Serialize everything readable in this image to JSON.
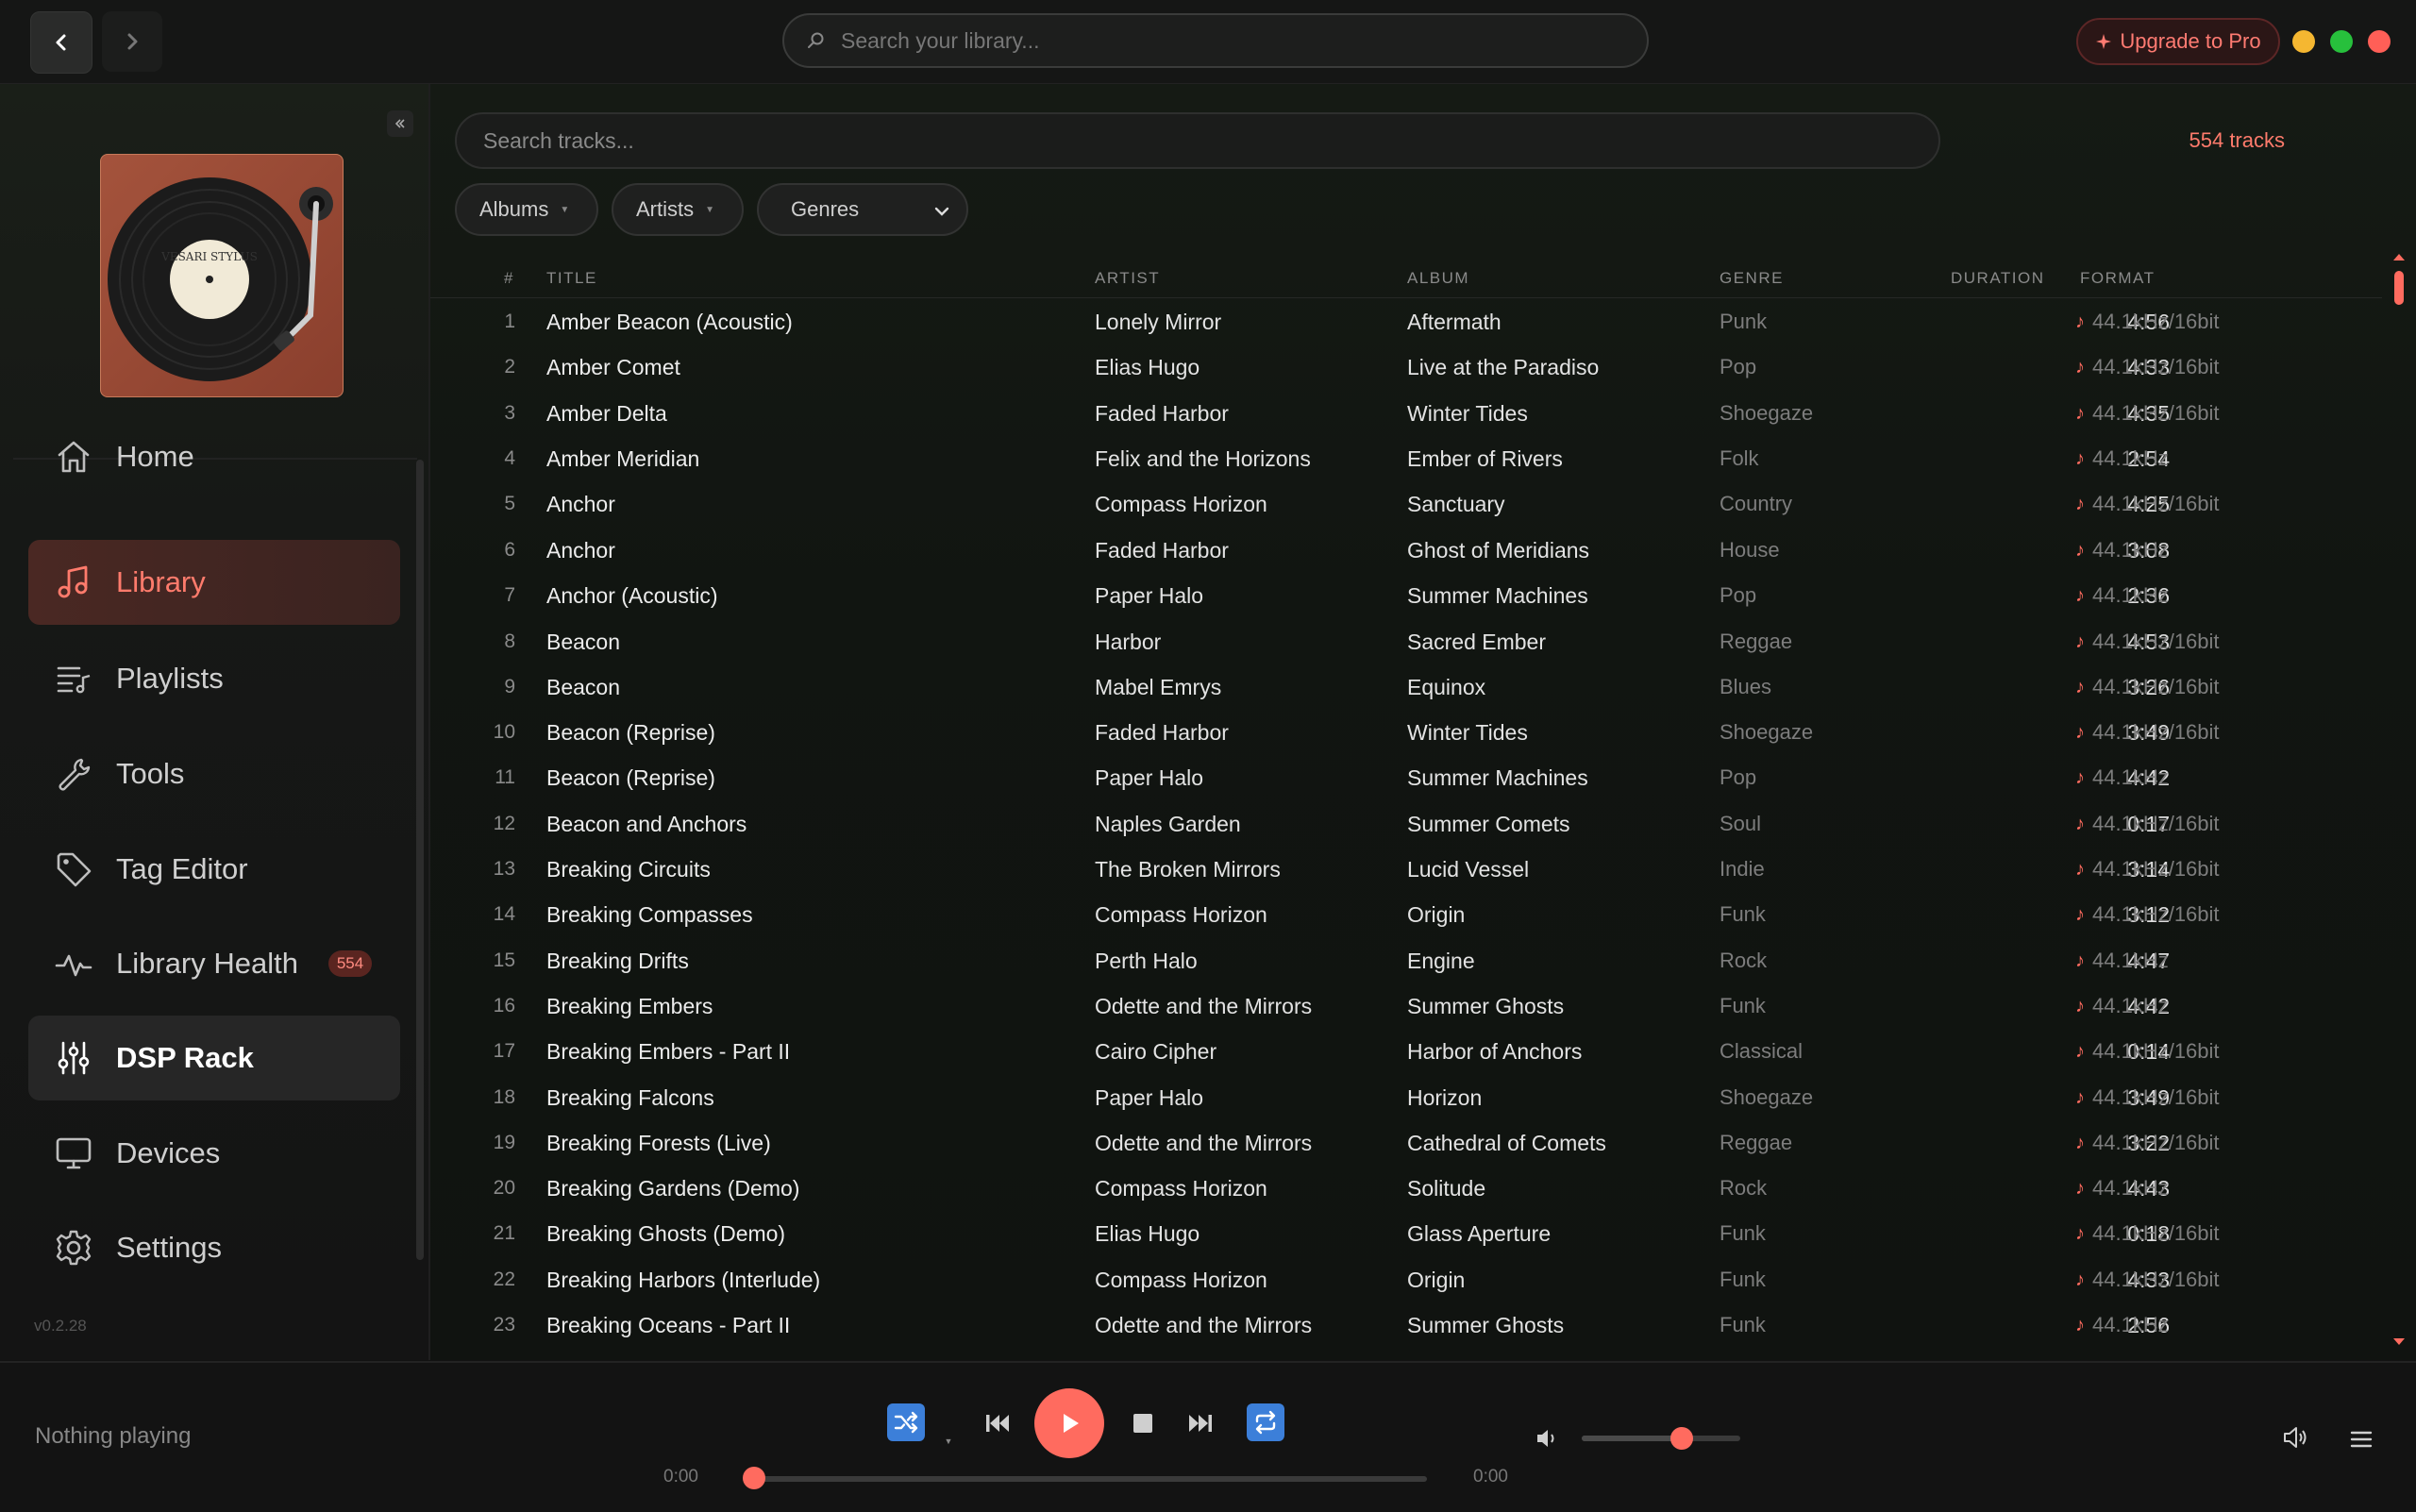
{
  "topbar": {
    "search_placeholder": "Search your library...",
    "upgrade_label": "Upgrade to Pro"
  },
  "sidebar": {
    "items": [
      {
        "label": "Home",
        "icon": "home-icon"
      },
      {
        "label": "Library",
        "icon": "music-note-icon",
        "active": true
      },
      {
        "label": "Playlists",
        "icon": "playlist-icon"
      },
      {
        "label": "Tools",
        "icon": "wrench-icon"
      },
      {
        "label": "Tag Editor",
        "icon": "tag-icon"
      },
      {
        "label": "Library Health",
        "icon": "pulse-icon",
        "badge": "554"
      },
      {
        "label": "DSP Rack",
        "icon": "sliders-icon",
        "hover": true
      },
      {
        "label": "Devices",
        "icon": "monitor-icon"
      },
      {
        "label": "Settings",
        "icon": "gear-icon"
      }
    ],
    "version": "v0.2.28",
    "album_art_text": "VESARI STYLUS"
  },
  "library": {
    "search_placeholder": "Search tracks...",
    "track_count": "554 tracks",
    "filters": {
      "albums": "Albums",
      "artists": "Artists",
      "genres": "Genres"
    },
    "columns": {
      "num": "#",
      "title": "TITLE",
      "artist": "ARTIST",
      "album": "ALBUM",
      "genre": "GENRE",
      "duration": "DURATION",
      "format": "FORMAT"
    },
    "tracks": [
      {
        "num": "1",
        "title": "Amber Beacon (Acoustic)",
        "artist": "Lonely Mirror",
        "album": "Aftermath",
        "genre": "Punk",
        "duration": "4:56",
        "format": "44.1kHz/16bit"
      },
      {
        "num": "2",
        "title": "Amber Comet",
        "artist": "Elias Hugo",
        "album": "Live at the Paradiso",
        "genre": "Pop",
        "duration": "4:33",
        "format": "44.1kHz/16bit"
      },
      {
        "num": "3",
        "title": "Amber Delta",
        "artist": "Faded Harbor",
        "album": "Winter Tides",
        "genre": "Shoegaze",
        "duration": "4:35",
        "format": "44.1kHz/16bit"
      },
      {
        "num": "4",
        "title": "Amber Meridian",
        "artist": "Felix and the Horizons",
        "album": "Ember of Rivers",
        "genre": "Folk",
        "duration": "2:54",
        "format": "44.1kHz"
      },
      {
        "num": "5",
        "title": "Anchor",
        "artist": "Compass Horizon",
        "album": "Sanctuary",
        "genre": "Country",
        "duration": "4:25",
        "format": "44.1kHz/16bit"
      },
      {
        "num": "6",
        "title": "Anchor",
        "artist": "Faded Harbor",
        "album": "Ghost of Meridians",
        "genre": "House",
        "duration": "3:08",
        "format": "44.1kHz"
      },
      {
        "num": "7",
        "title": "Anchor (Acoustic)",
        "artist": "Paper Halo",
        "album": "Summer Machines",
        "genre": "Pop",
        "duration": "2:36",
        "format": "44.1kHz"
      },
      {
        "num": "8",
        "title": "Beacon",
        "artist": "Harbor",
        "album": "Sacred Ember",
        "genre": "Reggae",
        "duration": "4:53",
        "format": "44.1kHz/16bit"
      },
      {
        "num": "9",
        "title": "Beacon",
        "artist": "Mabel Emrys",
        "album": "Equinox",
        "genre": "Blues",
        "duration": "3:26",
        "format": "44.1kHz/16bit"
      },
      {
        "num": "10",
        "title": "Beacon (Reprise)",
        "artist": "Faded Harbor",
        "album": "Winter Tides",
        "genre": "Shoegaze",
        "duration": "3:49",
        "format": "44.1kHz/16bit"
      },
      {
        "num": "11",
        "title": "Beacon (Reprise)",
        "artist": "Paper Halo",
        "album": "Summer Machines",
        "genre": "Pop",
        "duration": "4:42",
        "format": "44.1kHz"
      },
      {
        "num": "12",
        "title": "Beacon and Anchors",
        "artist": "Naples Garden",
        "album": "Summer Comets",
        "genre": "Soul",
        "duration": "0:17",
        "format": "44.1kHz/16bit"
      },
      {
        "num": "13",
        "title": "Breaking Circuits",
        "artist": "The Broken Mirrors",
        "album": "Lucid Vessel",
        "genre": "Indie",
        "duration": "3:14",
        "format": "44.1kHz/16bit"
      },
      {
        "num": "14",
        "title": "Breaking Compasses",
        "artist": "Compass Horizon",
        "album": "Origin",
        "genre": "Funk",
        "duration": "3:12",
        "format": "44.1kHz/16bit"
      },
      {
        "num": "15",
        "title": "Breaking Drifts",
        "artist": "Perth Halo",
        "album": "Engine",
        "genre": "Rock",
        "duration": "4:47",
        "format": "44.1kHz"
      },
      {
        "num": "16",
        "title": "Breaking Embers",
        "artist": "Odette and the Mirrors",
        "album": "Summer Ghosts",
        "genre": "Funk",
        "duration": "4:42",
        "format": "44.1kHz"
      },
      {
        "num": "17",
        "title": "Breaking Embers - Part II",
        "artist": "Cairo Cipher",
        "album": "Harbor of Anchors",
        "genre": "Classical",
        "duration": "0:14",
        "format": "44.1kHz/16bit"
      },
      {
        "num": "18",
        "title": "Breaking Falcons",
        "artist": "Paper Halo",
        "album": "Horizon",
        "genre": "Shoegaze",
        "duration": "3:49",
        "format": "44.1kHz/16bit"
      },
      {
        "num": "19",
        "title": "Breaking Forests (Live)",
        "artist": "Odette and the Mirrors",
        "album": "Cathedral of Comets",
        "genre": "Reggae",
        "duration": "3:22",
        "format": "44.1kHz/16bit"
      },
      {
        "num": "20",
        "title": "Breaking Gardens (Demo)",
        "artist": "Compass Horizon",
        "album": "Solitude",
        "genre": "Rock",
        "duration": "4:43",
        "format": "44.1kHz"
      },
      {
        "num": "21",
        "title": "Breaking Ghosts (Demo)",
        "artist": "Elias Hugo",
        "album": "Glass Aperture",
        "genre": "Funk",
        "duration": "0:18",
        "format": "44.1kHz/16bit"
      },
      {
        "num": "22",
        "title": "Breaking Harbors (Interlude)",
        "artist": "Compass Horizon",
        "album": "Origin",
        "genre": "Funk",
        "duration": "4:33",
        "format": "44.1kHz/16bit"
      },
      {
        "num": "23",
        "title": "Breaking Oceans - Part II",
        "artist": "Odette and the Mirrors",
        "album": "Summer Ghosts",
        "genre": "Funk",
        "duration": "2:56",
        "format": "44.1kHz"
      }
    ]
  },
  "player": {
    "now_playing": "Nothing playing",
    "elapsed": "0:00",
    "total": "0:00",
    "volume_level": 0.63,
    "accent": "#ff6b5f"
  }
}
